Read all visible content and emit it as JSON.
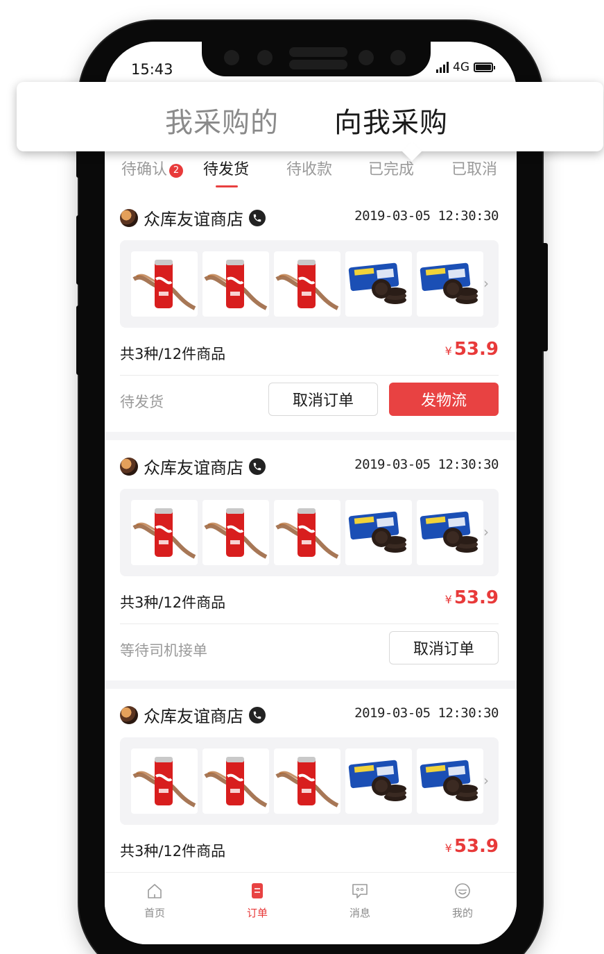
{
  "status_bar": {
    "time": "15:43",
    "network": "4G"
  },
  "segmented": {
    "left_label": "我采购的",
    "right_label": "向我采购"
  },
  "subtabs": [
    {
      "label": "待确认",
      "badge": "2"
    },
    {
      "label": "待发货"
    },
    {
      "label": "待收款"
    },
    {
      "label": "已完成"
    },
    {
      "label": "已取消"
    }
  ],
  "orders": [
    {
      "store": "众库友谊商店",
      "time": "2019-03-05 12:30:30",
      "summary": "共3种/12件商品",
      "currency": "¥",
      "amount": "53.9",
      "status": "待发货",
      "cancel_label": "取消订单",
      "primary_label": "发物流"
    },
    {
      "store": "众库友谊商店",
      "time": "2019-03-05 12:30:30",
      "summary": "共3种/12件商品",
      "currency": "¥",
      "amount": "53.9",
      "status": "等待司机接单",
      "cancel_label": "取消订单"
    },
    {
      "store": "众库友谊商店",
      "time": "2019-03-05 12:30:30",
      "summary": "共3种/12件商品",
      "currency": "¥",
      "amount": "53.9"
    }
  ],
  "product_thumbs": [
    "cola-can",
    "cola-can",
    "cola-can",
    "oreo-pack",
    "oreo-pack"
  ],
  "bottom_nav": [
    {
      "label": "首页",
      "icon": "home-icon"
    },
    {
      "label": "订单",
      "icon": "order-icon",
      "active": true
    },
    {
      "label": "消息",
      "icon": "message-icon"
    },
    {
      "label": "我的",
      "icon": "profile-icon"
    }
  ],
  "colors": {
    "accent": "#e84242",
    "background": "#f4f4f6"
  }
}
